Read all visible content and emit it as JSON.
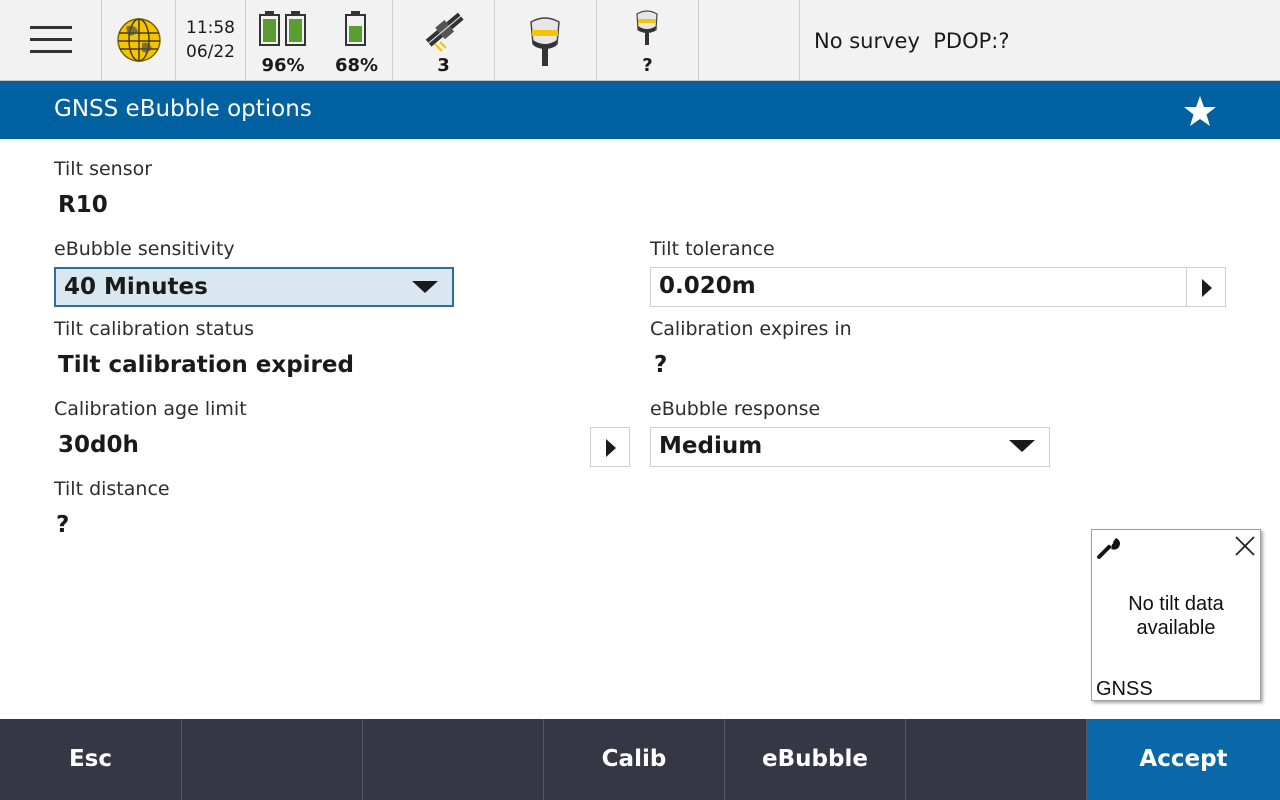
{
  "status_bar": {
    "time": "11:58",
    "date": "06/22",
    "battery_1_level": "96%",
    "battery_2_level": "68%",
    "satellites": "3",
    "receiver_2_label": "?",
    "survey_status": "No survey  PDOP:?",
    "icons": [
      "menu-icon",
      "globe-icon",
      "battery-icon",
      "satellite-icon",
      "gnss-receiver-icon"
    ]
  },
  "title_bar": {
    "title": "GNSS eBubble options",
    "icon": "star-icon"
  },
  "form": {
    "tilt_sensor": {
      "label": "Tilt sensor",
      "value": "R10"
    },
    "ebubble_sensitivity": {
      "label": "eBubble sensitivity",
      "value": "40 Minutes"
    },
    "tilt_tolerance": {
      "label": "Tilt tolerance",
      "value": "0.020m"
    },
    "tilt_calibration_status": {
      "label": "Tilt calibration status",
      "value": "Tilt calibration expired"
    },
    "calibration_expires_in": {
      "label": "Calibration expires in",
      "value": "?"
    },
    "calibration_age_limit": {
      "label": "Calibration age limit",
      "value": "30d0h"
    },
    "ebubble_response": {
      "label": "eBubble response",
      "value": "Medium"
    },
    "tilt_distance": {
      "label": "Tilt distance",
      "value": "?"
    }
  },
  "popup": {
    "message_line1": "No tilt data",
    "message_line2": "available",
    "footer": "GNSS"
  },
  "softkeys": [
    "Esc",
    "",
    "",
    "Calib",
    "eBubble",
    "",
    "Accept"
  ],
  "colors": {
    "title_bar": "#0061a0",
    "softkey_bar": "#363644",
    "accept_button": "#0a68a8",
    "battery_fill": "#5a9e32",
    "focus_field": "#d9e7f1"
  }
}
